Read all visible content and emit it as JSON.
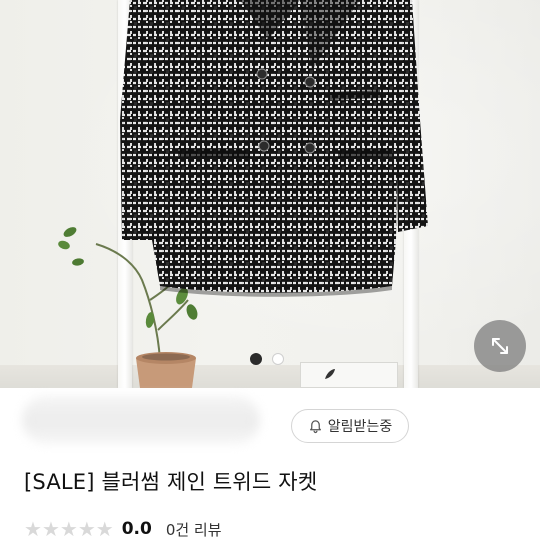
{
  "product_image": {
    "alt": "",
    "carousel": {
      "total": 2,
      "active_index": 0
    },
    "expand_icon": "expand-arrows-icon"
  },
  "seller": {
    "name": ""
  },
  "notify_button": {
    "label": "알림받는중",
    "icon": "bell-icon"
  },
  "product": {
    "title": "[SALE] 블러썸 제인 트위드 자켓"
  },
  "rating": {
    "stars_filled": 0,
    "stars_total": 5,
    "score": "0.0",
    "review_count_label": "0건 리뷰"
  },
  "colors": {
    "star_empty": "#d9d9d9",
    "dot_active": "#2b2b2b",
    "expand_bg": "#787878"
  }
}
